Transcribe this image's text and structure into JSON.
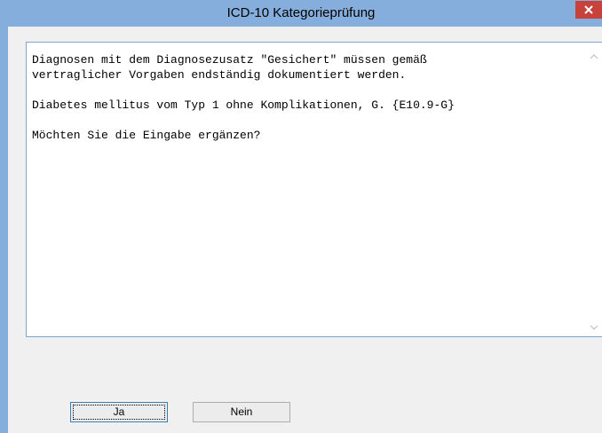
{
  "window": {
    "title": "ICD-10 Kategorieprüfung"
  },
  "message": {
    "lines": [
      "Diagnosen mit dem Diagnosezusatz \"Gesichert\" müssen gemäß",
      "vertraglicher Vorgaben endständig dokumentiert werden.",
      "",
      "Diabetes mellitus vom Typ 1 ohne Komplikationen, G. {E10.9-G}",
      "",
      "Möchten Sie die Eingabe ergänzen?"
    ]
  },
  "buttons": {
    "yes_label": "Ja",
    "no_label": "Nein"
  },
  "icons": {
    "close": "close-icon",
    "scroll_up": "chevron-up-icon",
    "scroll_down": "chevron-down-icon"
  },
  "colors": {
    "titlebar": "#85aedc",
    "close_button": "#c7423a",
    "client_background": "#f0f0f0",
    "message_border": "#7fa4d0"
  }
}
